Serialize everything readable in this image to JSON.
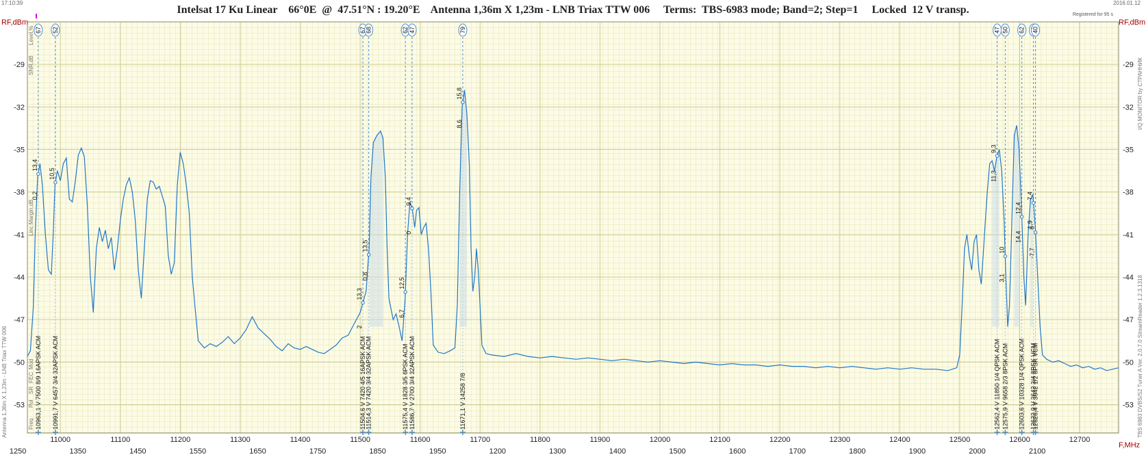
{
  "header": {
    "title": "Intelsat 17 Ku Linear    66°0E  @  47.51°N : 19.20°E    Antenna 1,36m X 1,23m - LNB Triax TTW 006     Terms:  TBS-6983 mode; Band=2; Step=1     Locked  12 V transp.",
    "time": "17:10:39",
    "date": "2016.01.12",
    "registered": "Registered for 95 s"
  },
  "side": {
    "left_vertical": "Antenna 1,36m X 1,23m - LNB Triax TTW 006",
    "right_vertical": "TBS 6983 DVBS/S2 Tuner A    Ver. 2.0.7.0    StreamReader 1.2.3.1318",
    "right_vertical_top": "I/Q MONITOR   by  СТРАННИК",
    "left_scale_labels": [
      "Level,%",
      "SNR,dB",
      "Linc Margin,dB"
    ],
    "left_table_labels": [
      "Freq",
      "Pol",
      "SR",
      "FEC",
      "Mod"
    ]
  },
  "chart_data": {
    "type": "line",
    "title": "Intelsat 17 Ku Linear",
    "ylabel_left": "RF,dBm",
    "ylabel_right": "RF,dBm",
    "xlabel": "F,MHz",
    "xlim": [
      10945,
      12765
    ],
    "ylim": [
      -55,
      -26
    ],
    "yticks": [
      -29,
      -32,
      -35,
      -38,
      -41,
      -44,
      -47,
      -50,
      -53
    ],
    "xticks_rf": [
      11000,
      11100,
      11200,
      11300,
      11400,
      11500,
      11600,
      11700,
      11800,
      11900,
      12000,
      12100,
      12200,
      12300,
      12400,
      12500,
      12600,
      12700
    ],
    "xticks_if_low": [
      "1250",
      "1350",
      "1450",
      "1550",
      "1650",
      "1750",
      "1850",
      "1950"
    ],
    "xticks_if_high": [
      "1200",
      "1300",
      "1400",
      "1500",
      "1600",
      "1700",
      "1800",
      "1900",
      "2000",
      "2100"
    ],
    "grid": true,
    "series": [
      {
        "color": "#1f77c9",
        "points": [
          [
            10945,
            -49.6
          ],
          [
            10950,
            -49.2
          ],
          [
            10955,
            -46
          ],
          [
            10958,
            -41
          ],
          [
            10962,
            -37
          ],
          [
            10966,
            -36
          ],
          [
            10970,
            -37.5
          ],
          [
            10975,
            -41
          ],
          [
            10980,
            -43.5
          ],
          [
            10985,
            -43.8
          ],
          [
            10988,
            -41
          ],
          [
            10991,
            -37.5
          ],
          [
            10995,
            -36.5
          ],
          [
            11000,
            -37.2
          ],
          [
            11005,
            -36
          ],
          [
            11010,
            -35.6
          ],
          [
            11015,
            -38.5
          ],
          [
            11020,
            -38.7
          ],
          [
            11025,
            -37.2
          ],
          [
            11030,
            -35.4
          ],
          [
            11035,
            -34.9
          ],
          [
            11040,
            -35.5
          ],
          [
            11045,
            -39
          ],
          [
            11050,
            -44
          ],
          [
            11055,
            -46.5
          ],
          [
            11060,
            -42
          ],
          [
            11065,
            -40.5
          ],
          [
            11070,
            -41.5
          ],
          [
            11075,
            -40.7
          ],
          [
            11080,
            -42
          ],
          [
            11085,
            -41.2
          ],
          [
            11090,
            -43.5
          ],
          [
            11095,
            -42
          ],
          [
            11100,
            -40
          ],
          [
            11105,
            -38.5
          ],
          [
            11110,
            -37.5
          ],
          [
            11115,
            -37
          ],
          [
            11120,
            -38
          ],
          [
            11125,
            -40
          ],
          [
            11130,
            -43.5
          ],
          [
            11135,
            -45.5
          ],
          [
            11140,
            -42
          ],
          [
            11145,
            -38.5
          ],
          [
            11150,
            -37.2
          ],
          [
            11155,
            -37.3
          ],
          [
            11160,
            -37.8
          ],
          [
            11165,
            -37.6
          ],
          [
            11170,
            -38.3
          ],
          [
            11175,
            -39
          ],
          [
            11180,
            -42.5
          ],
          [
            11185,
            -43.8
          ],
          [
            11190,
            -43
          ],
          [
            11195,
            -37.5
          ],
          [
            11200,
            -35.2
          ],
          [
            11205,
            -36
          ],
          [
            11210,
            -37.5
          ],
          [
            11215,
            -39.5
          ],
          [
            11220,
            -44
          ],
          [
            11225,
            -46.3
          ],
          [
            11230,
            -48.5
          ],
          [
            11240,
            -49
          ],
          [
            11250,
            -48.7
          ],
          [
            11260,
            -48.9
          ],
          [
            11270,
            -48.6
          ],
          [
            11280,
            -48.2
          ],
          [
            11290,
            -48.7
          ],
          [
            11300,
            -48.3
          ],
          [
            11310,
            -47.7
          ],
          [
            11320,
            -46.8
          ],
          [
            11330,
            -47.6
          ],
          [
            11340,
            -48
          ],
          [
            11350,
            -48.4
          ],
          [
            11360,
            -48.9
          ],
          [
            11370,
            -49.2
          ],
          [
            11380,
            -48.7
          ],
          [
            11390,
            -49
          ],
          [
            11400,
            -49.1
          ],
          [
            11410,
            -48.9
          ],
          [
            11420,
            -49.1
          ],
          [
            11430,
            -49.3
          ],
          [
            11440,
            -49.4
          ],
          [
            11450,
            -49.1
          ],
          [
            11460,
            -48.8
          ],
          [
            11470,
            -48.3
          ],
          [
            11480,
            -48.1
          ],
          [
            11490,
            -47.3
          ],
          [
            11500,
            -46.5
          ],
          [
            11510,
            -45
          ],
          [
            11515,
            -42
          ],
          [
            11518,
            -37
          ],
          [
            11522,
            -34.5
          ],
          [
            11528,
            -34
          ],
          [
            11534,
            -33.7
          ],
          [
            11538,
            -34.2
          ],
          [
            11542,
            -37
          ],
          [
            11545,
            -42
          ],
          [
            11548,
            -45.5
          ],
          [
            11555,
            -47
          ],
          [
            11560,
            -46.6
          ],
          [
            11565,
            -47.5
          ],
          [
            11570,
            -48.5
          ],
          [
            11575,
            -45.5
          ],
          [
            11579,
            -41
          ],
          [
            11583,
            -38.7
          ],
          [
            11587,
            -39.2
          ],
          [
            11591,
            -40.5
          ],
          [
            11594,
            -39.3
          ],
          [
            11598,
            -39.1
          ],
          [
            11602,
            -41
          ],
          [
            11606,
            -40.5
          ],
          [
            11610,
            -40.2
          ],
          [
            11614,
            -42
          ],
          [
            11618,
            -45
          ],
          [
            11622,
            -48.8
          ],
          [
            11630,
            -49.3
          ],
          [
            11640,
            -49.4
          ],
          [
            11650,
            -49.2
          ],
          [
            11658,
            -49
          ],
          [
            11662,
            -46
          ],
          [
            11666,
            -38
          ],
          [
            11670,
            -32
          ],
          [
            11674,
            -30.8
          ],
          [
            11678,
            -32.5
          ],
          [
            11682,
            -36
          ],
          [
            11685,
            -42
          ],
          [
            11688,
            -45
          ],
          [
            11691,
            -44
          ],
          [
            11694,
            -42
          ],
          [
            11697,
            -43.5
          ],
          [
            11700,
            -46
          ],
          [
            11703,
            -48.8
          ],
          [
            11710,
            -49.4
          ],
          [
            11720,
            -49.5
          ],
          [
            11740,
            -49.6
          ],
          [
            11760,
            -49.4
          ],
          [
            11780,
            -49.6
          ],
          [
            11800,
            -49.7
          ],
          [
            11820,
            -49.6
          ],
          [
            11840,
            -49.7
          ],
          [
            11860,
            -49.8
          ],
          [
            11880,
            -49.7
          ],
          [
            11900,
            -49.8
          ],
          [
            11920,
            -49.9
          ],
          [
            11940,
            -49.8
          ],
          [
            11960,
            -49.9
          ],
          [
            11980,
            -50
          ],
          [
            12000,
            -49.9
          ],
          [
            12020,
            -50
          ],
          [
            12040,
            -50.1
          ],
          [
            12060,
            -50
          ],
          [
            12080,
            -50.1
          ],
          [
            12100,
            -50.2
          ],
          [
            12120,
            -50.1
          ],
          [
            12140,
            -50.2
          ],
          [
            12160,
            -50.2
          ],
          [
            12180,
            -50.3
          ],
          [
            12200,
            -50.2
          ],
          [
            12220,
            -50.3
          ],
          [
            12240,
            -50.3
          ],
          [
            12260,
            -50.4
          ],
          [
            12280,
            -50.3
          ],
          [
            12300,
            -50.4
          ],
          [
            12320,
            -50.3
          ],
          [
            12340,
            -50.4
          ],
          [
            12360,
            -50.5
          ],
          [
            12380,
            -50.4
          ],
          [
            12400,
            -50.5
          ],
          [
            12420,
            -50.4
          ],
          [
            12440,
            -50.5
          ],
          [
            12460,
            -50.5
          ],
          [
            12480,
            -50.6
          ],
          [
            12495,
            -50.4
          ],
          [
            12500,
            -49.5
          ],
          [
            12504,
            -46
          ],
          [
            12508,
            -42
          ],
          [
            12512,
            -41
          ],
          [
            12516,
            -42.5
          ],
          [
            12520,
            -43.5
          ],
          [
            12524,
            -41.5
          ],
          [
            12528,
            -41
          ],
          [
            12532,
            -43.5
          ],
          [
            12536,
            -44.5
          ],
          [
            12539,
            -42.5
          ],
          [
            12542,
            -40.5
          ],
          [
            12546,
            -38
          ],
          [
            12550,
            -36
          ],
          [
            12554,
            -35.8
          ],
          [
            12558,
            -36.5
          ],
          [
            12562,
            -35.5
          ],
          [
            12566,
            -35
          ],
          [
            12570,
            -36.5
          ],
          [
            12574,
            -40
          ],
          [
            12577,
            -44
          ],
          [
            12580,
            -47.5
          ],
          [
            12583,
            -46
          ],
          [
            12587,
            -40
          ],
          [
            12591,
            -34
          ],
          [
            12595,
            -33.3
          ],
          [
            12599,
            -35
          ],
          [
            12603,
            -39
          ],
          [
            12607,
            -44
          ],
          [
            12610,
            -46
          ],
          [
            12614,
            -41
          ],
          [
            12618,
            -38.5
          ],
          [
            12622,
            -38.2
          ],
          [
            12626,
            -40.5
          ],
          [
            12630,
            -44
          ],
          [
            12634,
            -47.5
          ],
          [
            12638,
            -49.5
          ],
          [
            12645,
            -49.8
          ],
          [
            12655,
            -50
          ],
          [
            12665,
            -49.9
          ],
          [
            12675,
            -50.1
          ],
          [
            12685,
            -50.3
          ],
          [
            12695,
            -50.2
          ],
          [
            12705,
            -50.4
          ],
          [
            12715,
            -50.3
          ],
          [
            12725,
            -50.5
          ],
          [
            12735,
            -50.4
          ],
          [
            12745,
            -50.6
          ],
          [
            12755,
            -50.5
          ],
          [
            12765,
            -50.4
          ]
        ]
      }
    ],
    "markers": [
      {
        "freq": 10963.1,
        "level": "67",
        "snr": "13,4",
        "margin": "0,2",
        "table": "10963,1 V  7500 8/9 16APSK ACM"
      },
      {
        "freq": 10991.7,
        "level": "52",
        "snr": "10,5",
        "margin": "",
        "table": "10991,7 V  6457 3/4 32APSK ACM"
      },
      {
        "freq": 11504.6,
        "level": "67",
        "snr": "13,3",
        "margin": "2",
        "table": "11504,6 V  7420 4/5 16APSK ACM"
      },
      {
        "freq": 11514.3,
        "level": "68",
        "snr": "13,5",
        "margin": "0,8",
        "table": "11514,3 V  7420 3/4 32APSK ACM"
      },
      {
        "freq": 11575.4,
        "level": "62",
        "snr": "12,5",
        "margin": "6,7",
        "table": "11575,4 V  1828 3/5 8PSK ACM"
      },
      {
        "freq": 11586.7,
        "level": "47",
        "snr": "9,4",
        "margin": "0",
        "table": "11586,7 V  2700 3/4 32APSK ACM"
      },
      {
        "freq": 11671.1,
        "level": "79",
        "snr": "15,8",
        "margin": "8,6",
        "table": "11671,1 V  14258 7/8"
      },
      {
        "freq": 12562.4,
        "level": "47",
        "snr": "9,3",
        "margin": "11,3",
        "table": "12562,4 V  11850 1/4 QPSK ACM"
      },
      {
        "freq": 12575.9,
        "level": "50",
        "snr": "10",
        "margin": "3,1",
        "table": "12575,9 V  9658 2/3 8PSK ACM"
      },
      {
        "freq": 12603.6,
        "level": "62",
        "snr": "12,4",
        "margin": "14,4",
        "table": "12603,6 V  10328 1/4 QPSK ACM"
      },
      {
        "freq": 12623.0,
        "level": "40",
        "snr": "7,4",
        "margin": "1,9",
        "table": "12623,0 V  3642 3/4 8PSK VCM"
      },
      {
        "freq": 12626.4,
        "level": "40",
        "snr": "8",
        "margin": "-7,7",
        "table": "12626,4 V  3642 1/2 8PSK VCM"
      }
    ]
  }
}
